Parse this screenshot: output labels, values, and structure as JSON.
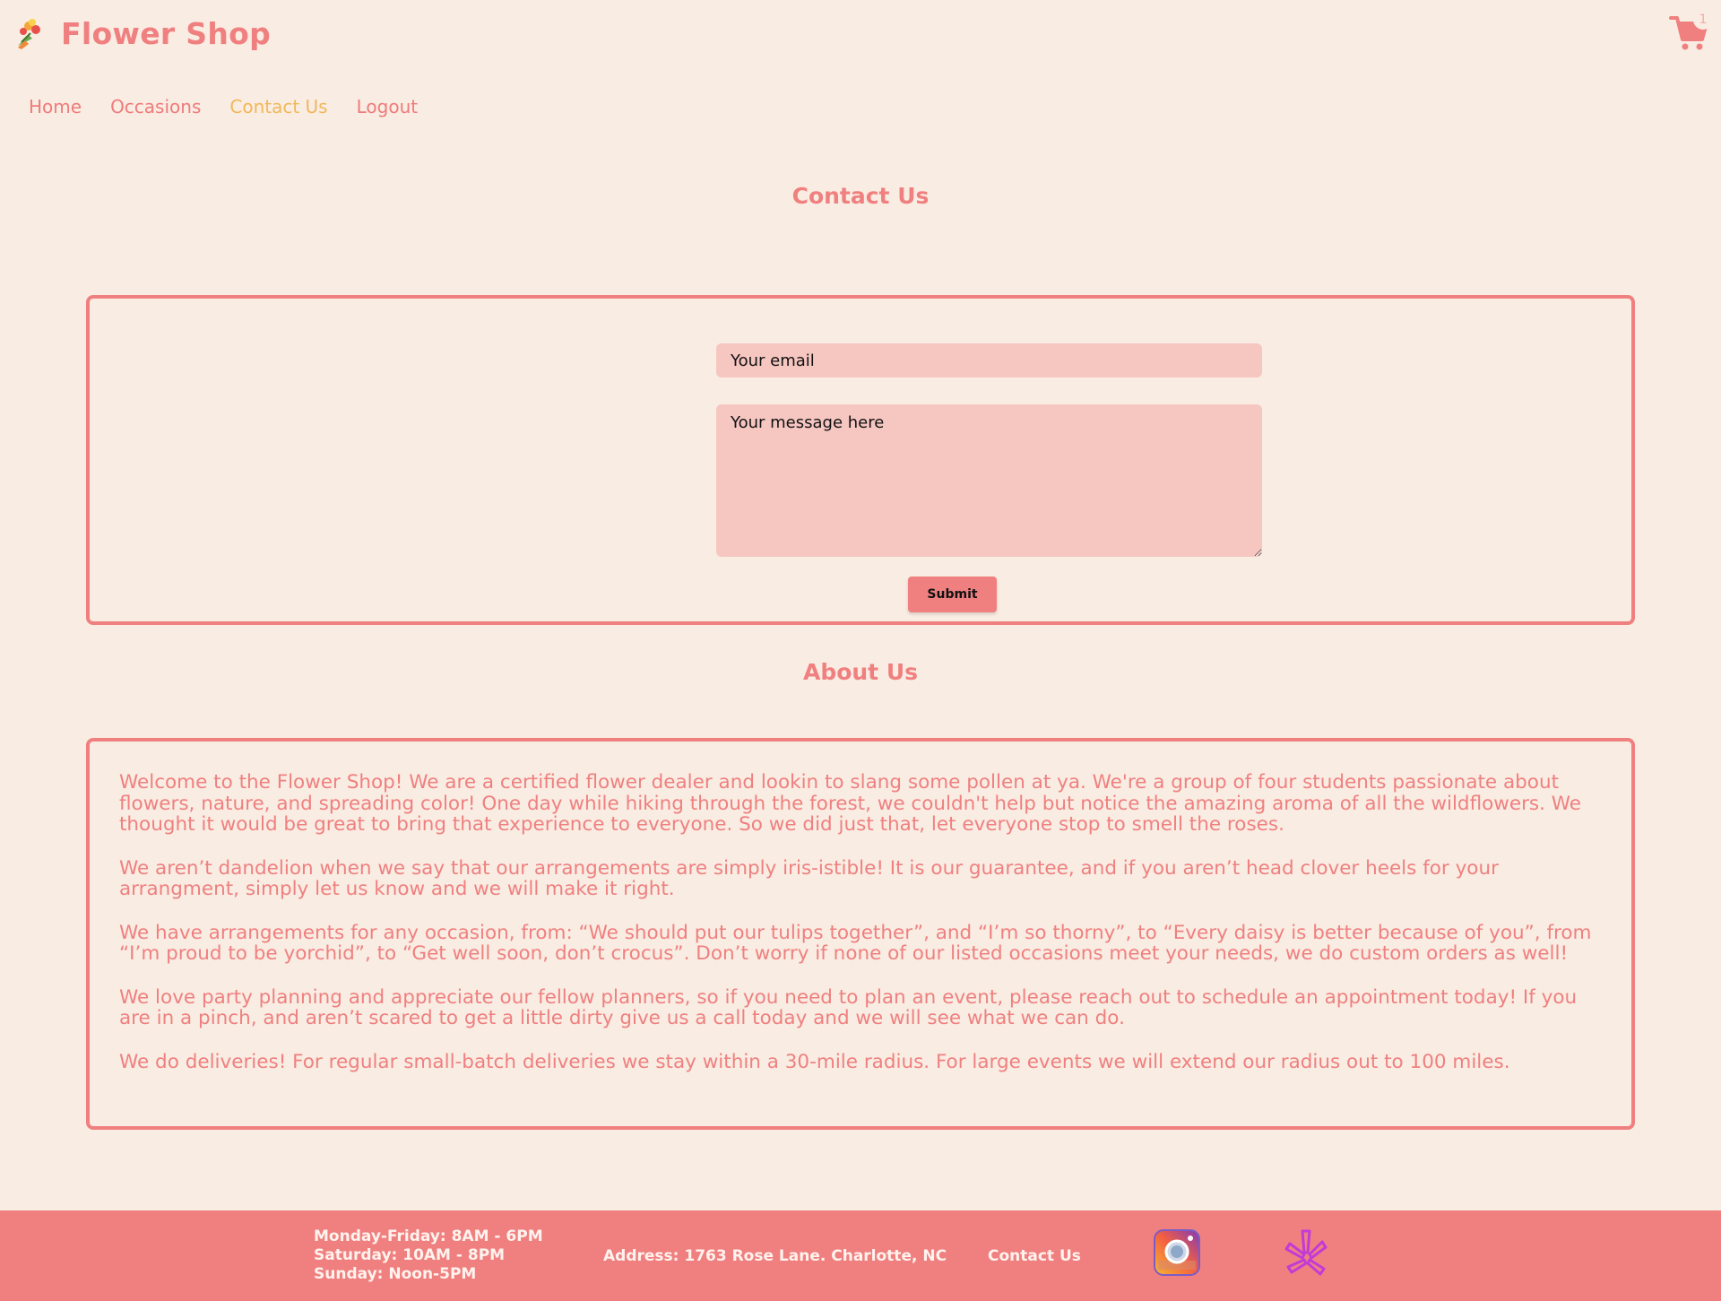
{
  "header": {
    "brand": "Flower Shop",
    "logo_icon": "bouquet-icon",
    "cart_icon": "shopping-cart-icon",
    "cart_count": "1"
  },
  "nav": [
    {
      "label": "Home"
    },
    {
      "label": "Occasions"
    },
    {
      "label": "Contact Us",
      "active": true
    },
    {
      "label": "Logout"
    }
  ],
  "contact": {
    "title": "Contact Us",
    "email_placeholder": "Your email",
    "message_placeholder": "Your message here",
    "submit_label": "Submit"
  },
  "about": {
    "title": "About Us",
    "paragraphs": [
      "Welcome to the Flower Shop! We are a certified flower dealer and lookin to slang some pollen at ya. We're a group of four students passionate about flowers, nature, and spreading color! One day while hiking through the forest, we couldn't help but notice the amazing aroma of all the wildflowers. We thought it would be great to bring that experience to everyone. So we did just that, let everyone stop to smell the roses.",
      "We aren’t dandelion when we say that our arrangements are simply iris-istible! It is our guarantee, and if you aren’t head clover heels for your arrangment, simply let us know and we will make it right.",
      "We have arrangements for any occasion, from: “We should put our tulips together”, and “I’m so thorny”, to “Every daisy is better because of you”, from “I’m proud to be yorchid”, to “Get well soon, don’t crocus”. Don’t worry if none of our listed occasions meet your needs, we do custom orders as well!",
      "We love party planning and appreciate our fellow planners, so if you need to plan an event, please reach out to schedule an appointment today! If you are in a pinch, and aren’t scared to get a little dirty give us a call today and we will see what we can do.",
      "We do deliveries! For regular small-batch deliveries we stay within a 30-mile radius. For large events we will extend our radius out to 100 miles."
    ]
  },
  "footer": {
    "hours": [
      "Monday-Friday: 8AM - 6PM",
      "Saturday: 10AM - 8PM",
      "Sunday: Noon-5PM"
    ],
    "address": "Address: 1763 Rose Lane. Charlotte, NC",
    "contact_label": "Contact Us",
    "social": [
      {
        "icon": "instagram-icon"
      },
      {
        "icon": "yelp-icon"
      }
    ]
  },
  "colors": {
    "background": "#f9ece2",
    "accent": "#f08080",
    "active_nav": "#f1b85a",
    "input_bg": "#f6c6c1"
  }
}
